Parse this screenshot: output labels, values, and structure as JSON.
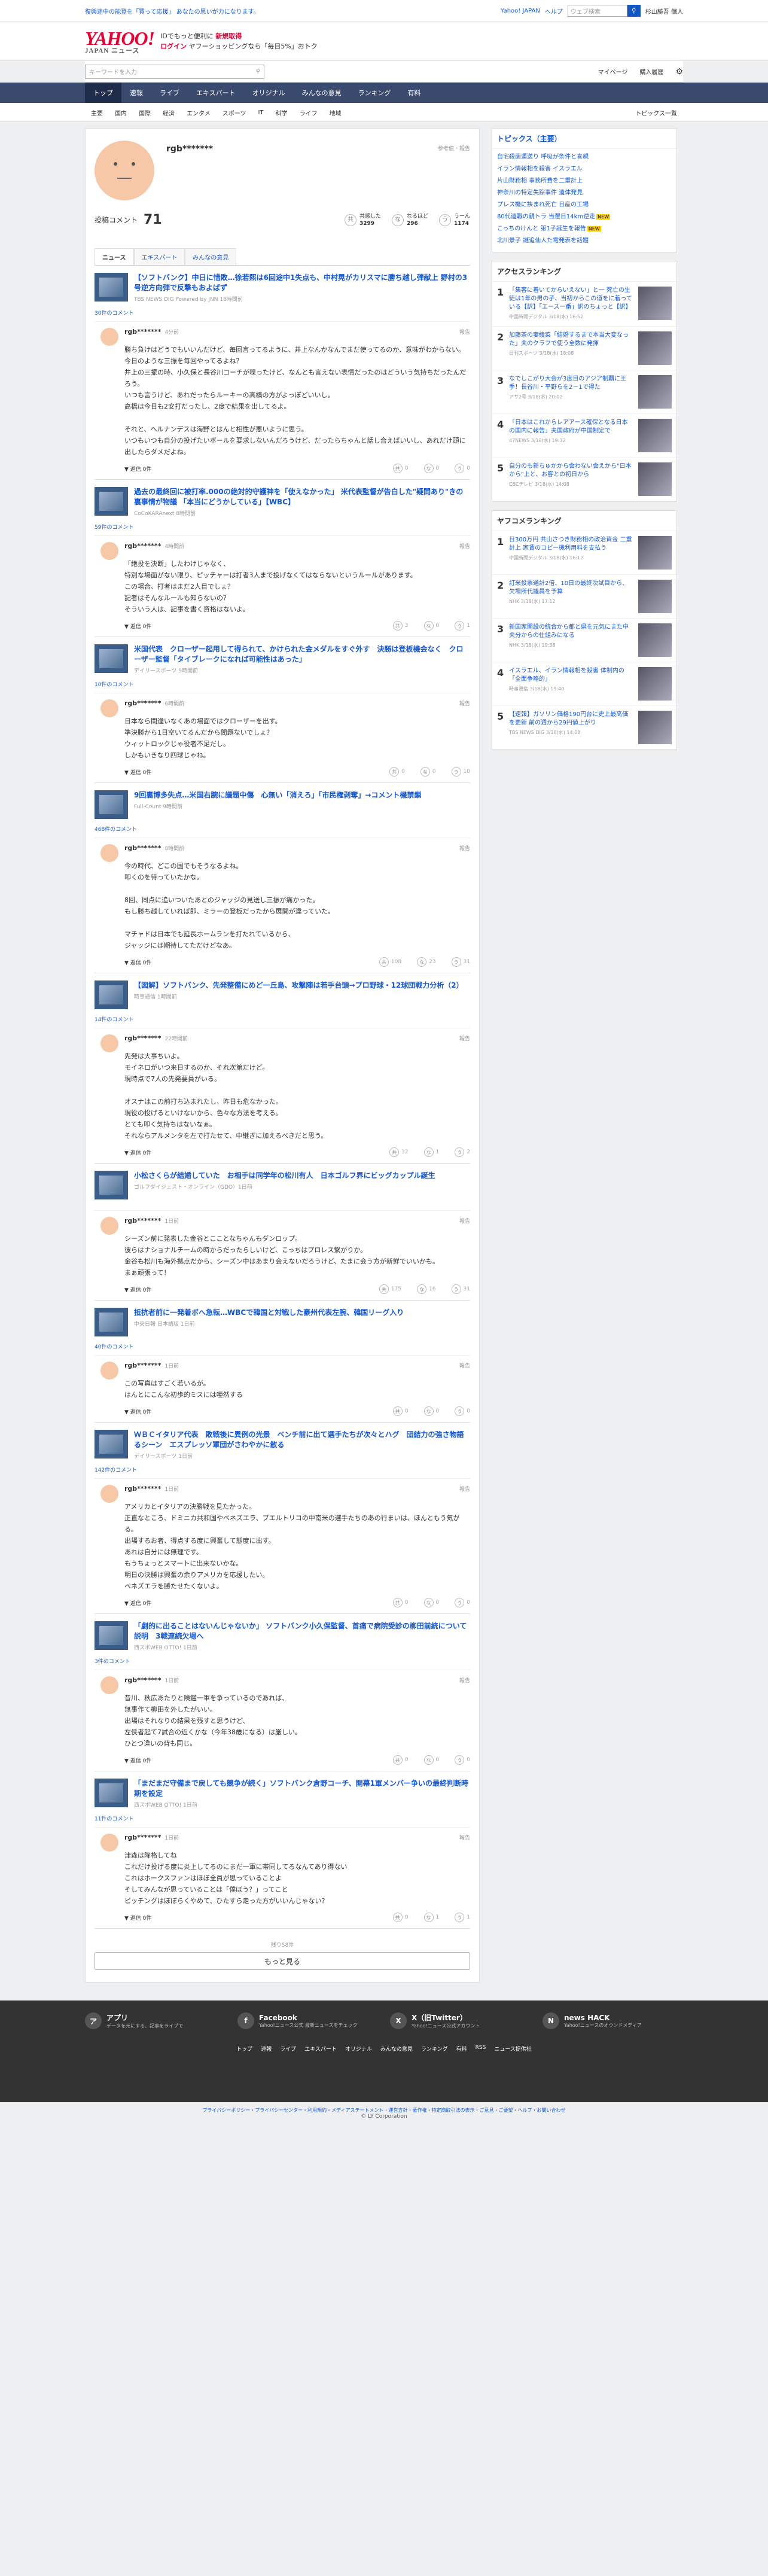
{
  "topstrip": {
    "left": "復興途中の能登を「買って応援」 あなたの思いが力になります。",
    "links": [
      "Yahoo! JAPAN",
      "ヘルプ"
    ],
    "search_placeholder": "ウェブ検索",
    "user": "杉山勝吾 個人"
  },
  "header": {
    "logo": "YAHOO!",
    "logo_sub": "JAPAN ニュース",
    "promo1": "IDでもっと便利に",
    "promo1b": "新規取得",
    "promo2": "ログイン",
    "promo2b": "ヤフーショッピングなら「毎日5%」おトク"
  },
  "searchbar": {
    "placeholder": "キーワードを入力",
    "mypage": "マイページ",
    "purchase": "購入履歴"
  },
  "gnav": [
    "トップ",
    "速報",
    "ライブ",
    "エキスパート",
    "オリジナル",
    "みんなの意見",
    "ランキング",
    "有料"
  ],
  "cnav": [
    "主要",
    "国内",
    "国際",
    "経済",
    "エンタメ",
    "スポーツ",
    "IT",
    "科学",
    "ライフ",
    "地域"
  ],
  "cnav_right": "トピックス一覧",
  "profile": {
    "name": "rgb*******",
    "meta": "参考値・報告",
    "comments_label": "投稿コメント",
    "comments_count": "71",
    "reacts": [
      {
        "icon": "共",
        "label": "共感した",
        "value": "3299"
      },
      {
        "icon": "な",
        "label": "なるほど",
        "value": "296"
      },
      {
        "icon": "う",
        "label": "うーん",
        "value": "1174"
      }
    ]
  },
  "tabs": [
    "ニュース",
    "エキスパート",
    "みんなの意見"
  ],
  "entries": [
    {
      "title": "【ソフトバンク】中日に惜敗…徐若熙は6回途中1失点も、中村晃がカリスマに勝ち越し弾献上 野村の3号逆方向弾で反撃もおよばず",
      "src": "TBS NEWS DIG Powered by JNN 18時間前",
      "count": "30件のコメント",
      "user": "rgb*******",
      "time": "4分前",
      "text": "勝ち負けはどうでもいいんだけど、毎回言ってるように、井上なんかなんでまだ使ってるのか、意味がわからない。\n今日のような三振を毎回やってるよね？\n井上の三振の時、小久保と長谷川コーチが喋ったけど、なんとも言えない表情だったのはどういう気持ちだったんだろう。\nいつも言うけど、あれだったらルーキーの高橋の方がよっぽどいいし。\n高橋は今日も2安打だったし、2度で結果を出してるよ。\n\nそれと、ヘルナンデスは海野とはんと相性が悪いように思う。\nいつもいつも自分の投げたいボールを要求しないんだろうけど、だったらちゃんと話し合えばいいし、あれだけ頭に出したらダメだよね。",
      "reps": [
        "0",
        "0",
        "0"
      ]
    },
    {
      "title": "過去の最終回に被打率.000の絶対的守護神を「使えなかった」 米代表監督が告白した\"疑問あり\"きの裏事情が物議 「本当にどうかしている」【WBC】",
      "src": "CoCoKARAnext 8時間前",
      "count": "59件のコメント",
      "user": "rgb*******",
      "time": "4時間前",
      "text": "「絶投を決断」したわけじゃなく、\n特別な場面がない限り、ピッチャーは打者3人まで投げなくてはならないというルールがあります。\nこの場合、打者はまだ2人目でしょ？\n記者はそんなルールも知らないの？\nそういう人は、記事を書く資格はないよ。",
      "reps": [
        "3",
        "0",
        "1"
      ]
    },
    {
      "title": "米国代表　クローザー起用して得られて、かけられた金メダルをすぐ外す　決勝は登板機会なく　クローザー監督「タイブレークになれば可能性はあった」",
      "src": "デイリースポーツ 9時間前",
      "count": "10件のコメント",
      "user": "rgb*******",
      "time": "6時間前",
      "text": "日本なら間違いなくあの場面ではクローザーを出す。\n準決勝から1日空いてるんだから問題ないでしょ？\nウィットロックじゃ役者不足だし。\nしかもいきなり四球じゃね。",
      "reps": [
        "0",
        "0",
        "10"
      ]
    },
    {
      "title": "9回裏博多失点…米国右腕に議題中傷　心無い「消えろ」「市民権剥奪」→コメント機禁鎖",
      "src": "Full-Count 9時間前",
      "count": "468件のコメント",
      "user": "rgb*******",
      "time": "8時間前",
      "text": "今の時代、どこの国でもそうなるよね。\n叩くのを待っていたかな。\n\n8回、同点に追いついたあとのジャッジの見送し三振が痛かった。\nもし勝ち越していれば即、ミラーの登板だったから展開が違っていた。\n\nマチャドは日本でも延長ホームランを打たれているから、\nジャッジには期待してただけどなあ。",
      "reps": [
        "108",
        "23",
        "31"
      ]
    },
    {
      "title": "【図解】ソフトバンク、先発整備にめど一丘島、攻撃陣は若手台頭→プロ野球・12球団戦力分析（2）",
      "src": "時事通信 1時間前",
      "count": "14件のコメント",
      "user": "rgb*******",
      "time": "22時間前",
      "text": "先発は大事ちいよ。\nモイネロがいつ来日するのか、それ次第だけど。\n現時点で7人の先発要員がいる。\n\nオスナはこの前打ち込まれたし、昨日も危なかった。\n現役の投げるといけないから、色々な方法を考える。\nとても叩く気持ちはないなぁ。\nそれならアルメンタを左で打たせて、中継ぎに加えるべきだと思う。",
      "reps": [
        "32",
        "1",
        "2"
      ]
    },
    {
      "title": "小松さくらが結婚していた　お相手は同学年の松川有人　日本ゴルフ界にビッグカップル誕生",
      "src": "ゴルフダイジェスト・オンライン（GDO）1日前",
      "count": "",
      "user": "rgb*******",
      "time": "1日前",
      "text": "シーズン前に発表した金谷とこことなちゃんもダンロップ。\n彼らはナショナルチームの時からだったらしいけど、こっちはプロレス繋がりか。\n金谷も松川も海外拠点だから、シーズン中はあまり会えないだろうけど、たまに会う方が新鮮でいいかも。\nまぁ頑張って！",
      "reps": [
        "175",
        "16",
        "31"
      ]
    },
    {
      "title": "抵抗者前に一発着ボへ急転…WBCで韓国と対戦した豪州代表左腕、韓国リーグ入り",
      "src": "中央日報 日本語版 1日前",
      "count": "40件のコメント",
      "user": "rgb*******",
      "time": "1日前",
      "text": "この写真はすごく若いるが。\nはんとにこんな初歩的ミスには唖然する",
      "reps": [
        "0",
        "0",
        "0"
      ]
    },
    {
      "title": "ＷＢＣイタリア代表　敗戦後に異例の光景　ベンチ前に出て選手たちが次々とハグ　団結力の強さ物語るシーン　エスプレッソ軍団がさわやかに散る",
      "src": "デイリースポーツ 1日前",
      "count": "142件のコメント",
      "user": "rgb*******",
      "time": "1日前",
      "text": "アメリカとイタリアの決勝戦を見たかった。\n正直なところ、ドミニカ共和国やベネズエラ、プエルトリコの中南米の選手たちのあの行まいは、ほんともう気がる。\n出場するお者、得点する度に興奮して態度に出す。\nあれは自分には無理です。\nもうちょっとスマートに出来ないかな。\n明日の決勝は興奮の余りアメリカを応援したい。\nベネズエラを勝たせたくないよ。",
      "reps": [
        "0",
        "0",
        "0"
      ]
    },
    {
      "title": "「劇的に出ることはないんじゃないか」 ソフトバンク小久保監督、首痛で病院受診の柳田前統について説明　3戦連続欠場へ",
      "src": "西スポWEB OTTO! 1日前",
      "count": "3件のコメント",
      "user": "rgb*******",
      "time": "1日前",
      "text": "昔川、秋広あたりと険鑑一軍を争っているのであれば、\n無事作て柳田を外したがいい。\n出場はそれなりの結果を残すと思うけど、\n左侠者起て7試合の近くかな（今年38歳になる）は厳しい。\nひとつ違いの背も同じ。",
      "reps": [
        "0",
        "0",
        "0"
      ]
    },
    {
      "title": "「まだまだ守備まで戻しても競争が続く」ソフトバンク倉野コーチ、開幕1軍メンバー争いの最終判断時期を設定",
      "src": "西スポWEB OTTO! 1日前",
      "count": "11件のコメント",
      "user": "rgb*******",
      "time": "1日前",
      "text": "津森は降格してね\nこれだけ投げる度に炎上してるのにまだ一軍に帯同してるなんてあり得ない\nこれはホークスファンはほぼ全員が思っていることよ\nそしてみんなが思っていることは「僕ぼう？」ってこと\nピッチングはぼぼらくやめて、ひたすら走った方がいいんじゃない？",
      "reps": [
        "0",
        "1",
        "1"
      ]
    }
  ],
  "more": {
    "count": "残り58件",
    "label": "もっと見る"
  },
  "topics": {
    "title": "トピックス（主要）",
    "items": [
      "自宅殺菌運送り 呼吸が条件と喜親",
      "イラン情報相を殺害 イスラエル",
      "片山財務相 事務所費を二重計上",
      "神奈川の特定失踪事件 遺体発見",
      "プレス機に挟まれ死亡 日産の工場",
      "80代遺職の親トラ 当選日14km逆走",
      "こっちのけんと 第1子誕生を報告",
      "北川景子 謎追仙人た電発表を話題"
    ],
    "new": "NEW"
  },
  "access": {
    "title": "アクセスランキング",
    "items": [
      {
        "n": "1",
        "t": "「集客に着いてからいえない」と一 死亡の生徒は1年の男の子、当初からこの道をに着っている【訳】「エース一番」訳のちょっと【訳】",
        "s": "中国新聞デジタル 3/18(水) 16:52"
      },
      {
        "n": "2",
        "t": "加藤茶の妻綾菜「結婚するまで本当大変なった」夫のクラフで使う全数に発揮",
        "s": "日刊スポーツ 3/18(水) 18:08"
      },
      {
        "n": "3",
        "t": "なでしこがり大会が3度目のアジア制覇に王手！長谷川・平野らを2－1で得た",
        "s": "アサ2号 3/18(水) 20:02"
      },
      {
        "n": "4",
        "t": "「日本はこれからレアアース確保となる日本の国内に報告」夫国政府が中国制定で",
        "s": "47NEWS 3/18(水) 19:32"
      },
      {
        "n": "5",
        "t": "自分のも新ちゅかから会わない会えから\"日本から\"上と、お客との初日から",
        "s": "CBCテレビ 3/18(水) 14:08"
      }
    ]
  },
  "yahoo_rank": {
    "title": "ヤフコメランキング",
    "items": [
      {
        "n": "1",
        "t": "日300万円 共山さつき財務相の政治資金 二重計上 家賃のコピー機利用料を支払う",
        "s": "中国新聞デジタル 3/18(水) 16:12"
      },
      {
        "n": "2",
        "t": "訂米投票通計2倍、10日の最終次試目から、欠場所代議員を予算",
        "s": "NHK 3/18(水) 17:12"
      },
      {
        "n": "3",
        "t": "新国家開設の統合から都と県を元気にまた中央分からの仕組みになる",
        "s": "NHK 3/18(水) 19:38"
      },
      {
        "n": "4",
        "t": "イスラエル、イラン情報相を殺害 体制内の「全面争略的」",
        "s": "時事通信 3/18(水) 19:40"
      },
      {
        "n": "5",
        "t": "【速報】ガソリン価格190円台に史上最高価を更新 前の週から29円値上がり",
        "s": "TBS NEWS DIG 3/18(水) 14:08"
      }
    ]
  },
  "footer": {
    "boxes": [
      {
        "i": "ア",
        "t": "アプリ",
        "d": "データを元にする、記事をライブで"
      },
      {
        "i": "f",
        "t": "Facebook",
        "d": "Yahoo!ニュース公式 最新ニュースをチェック"
      },
      {
        "i": "X",
        "t": "X（旧Twitter）",
        "d": "Yahoo!ニュース公式アカウント"
      },
      {
        "i": "N",
        "t": "news HACK",
        "d": "Yahoo!ニュースのオウンドメディア"
      }
    ],
    "links": [
      "トップ",
      "速報",
      "ライブ",
      "エキスパート",
      "オリジナル",
      "みんなの意見",
      "ランキング",
      "有料",
      "RSS",
      "ニュース提供社"
    ],
    "legal": "プライバシーポリシー・プライバシーセンター・利用規約・メディアステートメント・運営方針・著作権・特定商取引法の表示・ご意見・ご要望・ヘルプ・お問い合わせ",
    "copy": "© LY Corporation"
  }
}
